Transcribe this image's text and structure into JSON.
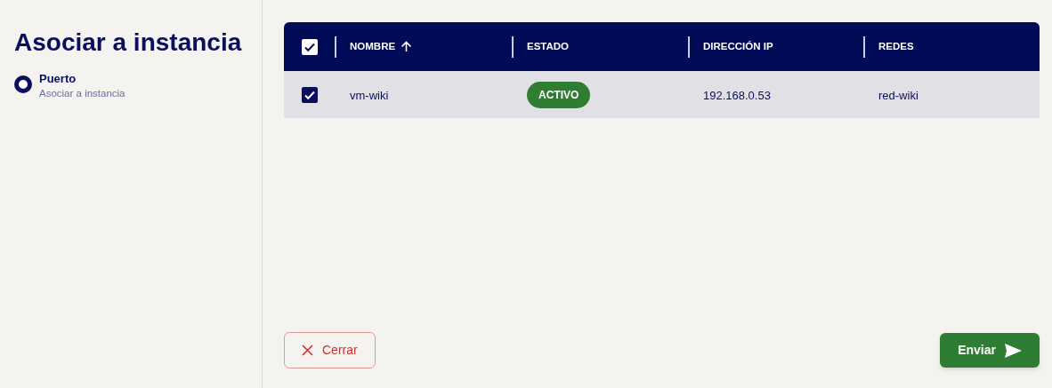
{
  "title": "Asociar a instancia",
  "steps": [
    {
      "title": "Puerto",
      "subtitle": "Asociar a instancia",
      "selected": true
    }
  ],
  "table": {
    "all_checked": true,
    "columns": [
      {
        "label": "NOMBRE",
        "sorted": true
      },
      {
        "label": "ESTADO"
      },
      {
        "label": "DIRECCIÓN IP"
      },
      {
        "label": "REDES"
      }
    ],
    "rows": [
      {
        "checked": true,
        "selected": true,
        "nombre": "vm-wiki",
        "estado": {
          "label": "ACTIVO",
          "color": "#2e7d32"
        },
        "ip": "192.168.0.53",
        "redes": "red-wiki"
      }
    ]
  },
  "buttons": [
    {
      "kind": "close",
      "label": "Cerrar"
    },
    {
      "kind": "submit",
      "label": "Enviar"
    }
  ]
}
